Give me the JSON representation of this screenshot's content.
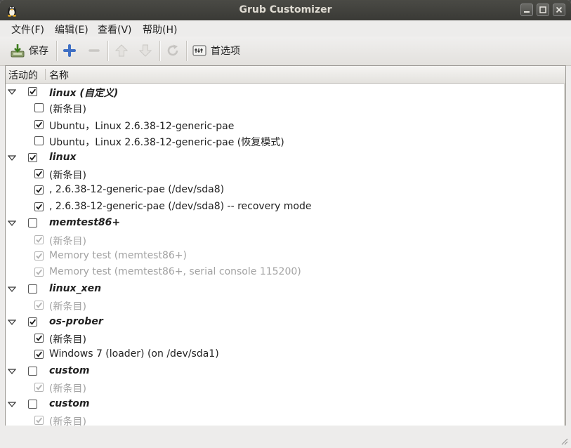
{
  "window": {
    "title": "Grub Customizer"
  },
  "menu": {
    "items": [
      "文件(F)",
      "编辑(E)",
      "查看(V)",
      "帮助(H)"
    ]
  },
  "toolbar": {
    "save_label": "保存",
    "prefs_label": "首选项"
  },
  "tree": {
    "columns": [
      "活动的",
      "名称"
    ],
    "rows": [
      {
        "label": "linux (自定义)",
        "group": true,
        "checked": true,
        "enabled": true
      },
      {
        "label": "(新条目)",
        "group": false,
        "checked": false,
        "enabled": true
      },
      {
        "label": "Ubuntu，Linux 2.6.38-12-generic-pae",
        "group": false,
        "checked": true,
        "enabled": true
      },
      {
        "label": "Ubuntu，Linux 2.6.38-12-generic-pae (恢复模式)",
        "group": false,
        "checked": false,
        "enabled": true
      },
      {
        "label": "linux",
        "group": true,
        "checked": true,
        "enabled": true
      },
      {
        "label": "(新条目)",
        "group": false,
        "checked": true,
        "enabled": true
      },
      {
        "label": ", 2.6.38-12-generic-pae (/dev/sda8)",
        "group": false,
        "checked": true,
        "enabled": true
      },
      {
        "label": ", 2.6.38-12-generic-pae (/dev/sda8) -- recovery mode",
        "group": false,
        "checked": true,
        "enabled": true
      },
      {
        "label": "memtest86+",
        "group": true,
        "checked": false,
        "enabled": true
      },
      {
        "label": "(新条目)",
        "group": false,
        "checked": true,
        "enabled": false
      },
      {
        "label": "Memory test (memtest86+)",
        "group": false,
        "checked": true,
        "enabled": false
      },
      {
        "label": "Memory test (memtest86+, serial console 115200)",
        "group": false,
        "checked": true,
        "enabled": false
      },
      {
        "label": "linux_xen",
        "group": true,
        "checked": false,
        "enabled": true
      },
      {
        "label": "(新条目)",
        "group": false,
        "checked": true,
        "enabled": false
      },
      {
        "label": "os-prober",
        "group": true,
        "checked": true,
        "enabled": true
      },
      {
        "label": "(新条目)",
        "group": false,
        "checked": true,
        "enabled": true
      },
      {
        "label": "Windows 7 (loader) (on /dev/sda1)",
        "group": false,
        "checked": true,
        "enabled": true
      },
      {
        "label": "custom",
        "group": true,
        "checked": false,
        "enabled": true
      },
      {
        "label": "(新条目)",
        "group": false,
        "checked": true,
        "enabled": false
      },
      {
        "label": "custom",
        "group": true,
        "checked": false,
        "enabled": true
      },
      {
        "label": "(新条目)",
        "group": false,
        "checked": true,
        "enabled": false
      }
    ]
  }
}
